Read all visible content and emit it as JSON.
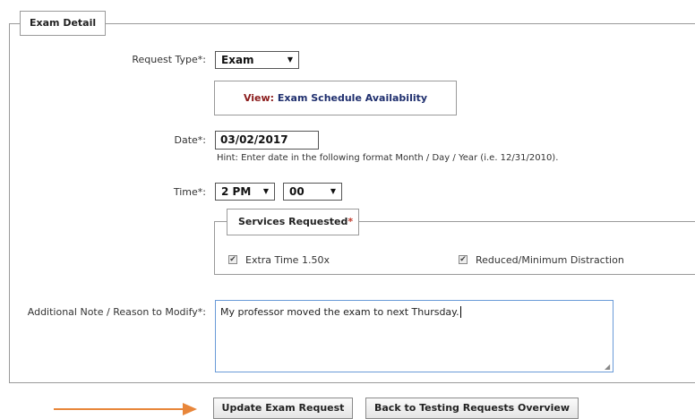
{
  "section": {
    "legend": "Exam Detail"
  },
  "request_type": {
    "label": "Request Type*:",
    "value": "Exam"
  },
  "schedule_link": {
    "prefix": "View:",
    "text": "Exam Schedule Availability"
  },
  "date": {
    "label": "Date*:",
    "value": "03/02/2017",
    "hint": "Hint: Enter date in the following format Month / Day / Year (i.e. 12/31/2010)."
  },
  "time": {
    "label": "Time*:",
    "hour": "2 PM",
    "minute": "00"
  },
  "services": {
    "legend": "Services Requested",
    "required_mark": "*",
    "items": [
      {
        "label": "Extra Time 1.50x",
        "checked": true
      },
      {
        "label": "Reduced/Minimum Distraction",
        "checked": true
      }
    ]
  },
  "note": {
    "label": "Additional Note / Reason to Modify*:",
    "value": "My professor moved the exam to next Thursday."
  },
  "buttons": {
    "update": "Update Exam Request",
    "back": "Back to Testing Requests Overview"
  },
  "colors": {
    "arrow": "#e8863a",
    "link": "#1f2f6e",
    "view_prefix": "#8b1c1c",
    "required": "#c0392b"
  },
  "icons": {
    "dropdown": "chevron-down-icon",
    "checkbox": "checkmark-icon",
    "pointer": "arrow-right-icon"
  }
}
